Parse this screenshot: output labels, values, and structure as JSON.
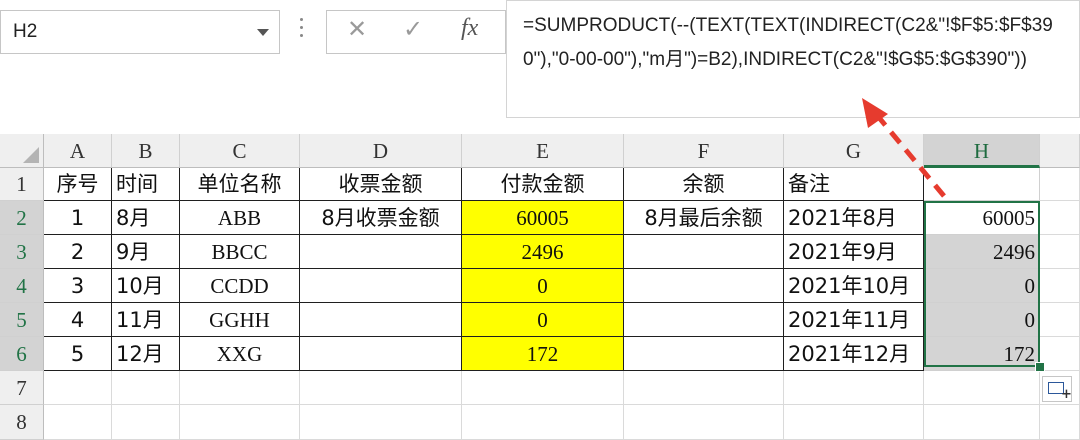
{
  "formula_bar": {
    "name_box": "H2",
    "cancel_icon": "✕",
    "enter_icon": "✓",
    "fx_label": "fx",
    "formula": "=SUMPRODUCT(--(TEXT(TEXT(INDIRECT(C2&\"!$F$5:$F$390\"),\"0-00-00\"),\"m月\")=B2),INDIRECT(C2&\"!$G$5:$G$390\"))"
  },
  "columns": [
    "A",
    "B",
    "C",
    "D",
    "E",
    "F",
    "G",
    "H"
  ],
  "rows": [
    {
      "num": "1",
      "A": "序号",
      "B": "时间",
      "C": "单位名称",
      "D": "收票金额",
      "E": "付款金额",
      "F": "余额",
      "G": "备注",
      "H": ""
    },
    {
      "num": "2",
      "A": "1",
      "B": "8月",
      "C": "ABB",
      "D": "8月收票金额",
      "E": "60005",
      "F": "8月最后余额",
      "G": "2021年8月",
      "H": "60005"
    },
    {
      "num": "3",
      "A": "2",
      "B": "9月",
      "C": "BBCC",
      "D": "",
      "E": "2496",
      "F": "",
      "G": "2021年9月",
      "H": "2496"
    },
    {
      "num": "4",
      "A": "3",
      "B": "10月",
      "C": "CCDD",
      "D": "",
      "E": "0",
      "F": "",
      "G": "2021年10月",
      "H": "0"
    },
    {
      "num": "5",
      "A": "4",
      "B": "11月",
      "C": "GGHH",
      "D": "",
      "E": "0",
      "F": "",
      "G": "2021年11月",
      "H": "0"
    },
    {
      "num": "6",
      "A": "5",
      "B": "12月",
      "C": "XXG",
      "D": "",
      "E": "172",
      "F": "",
      "G": "2021年12月",
      "H": "172"
    },
    {
      "num": "7"
    },
    {
      "num": "8"
    }
  ],
  "colors": {
    "highlight_yellow": "#ffff00",
    "selection_grey": "#d4d4d4",
    "excel_green": "#217346",
    "arrow_red": "#e63b2e"
  },
  "icons": {
    "arrow": "red-dashed-arrow",
    "quick_analysis": "quick-analysis-icon"
  }
}
